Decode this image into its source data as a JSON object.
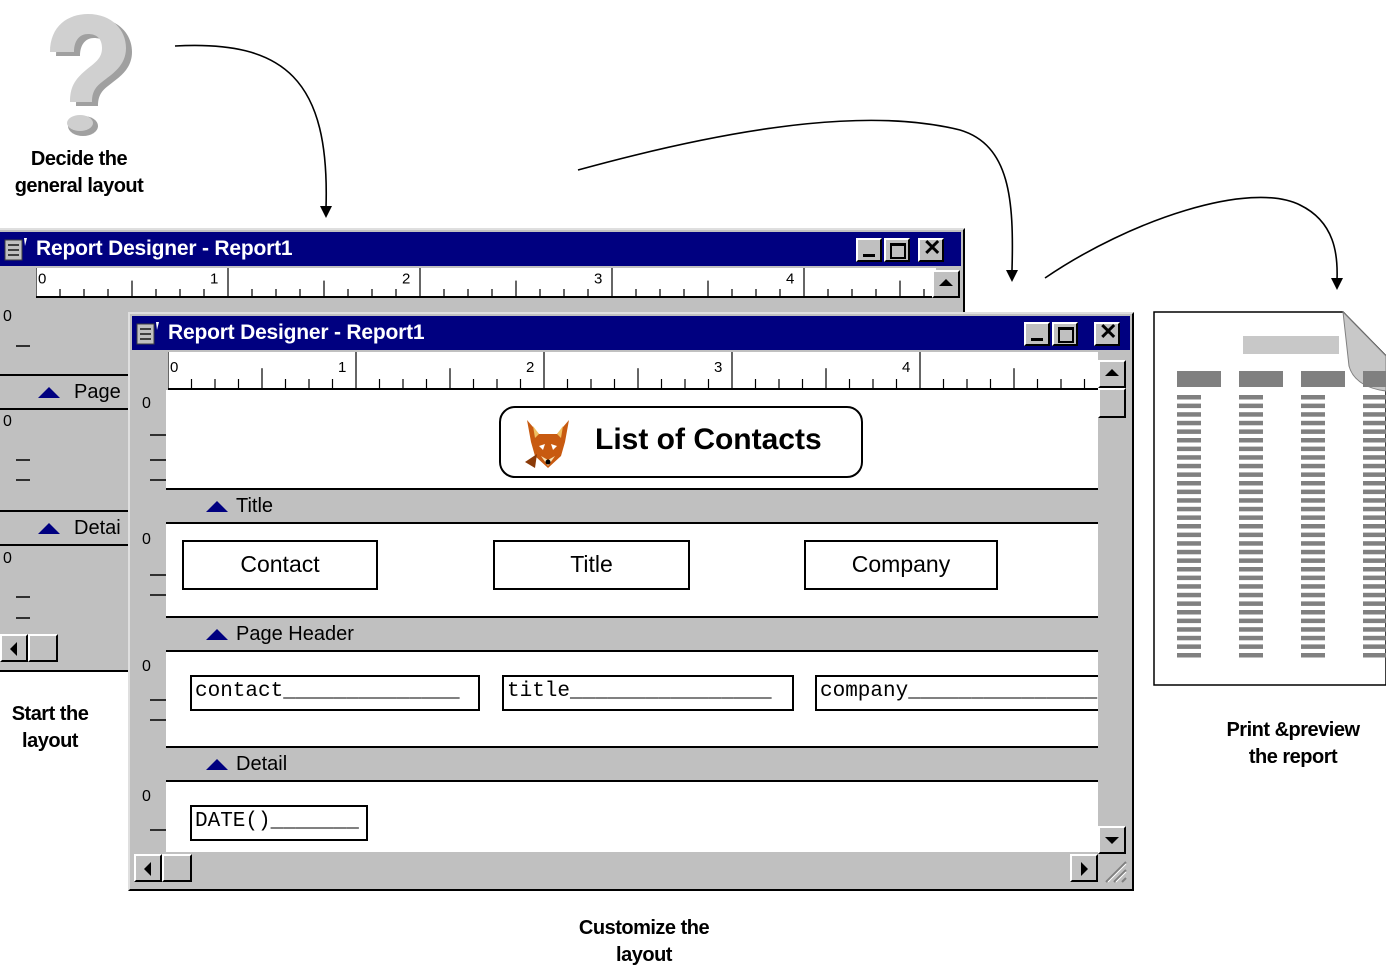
{
  "captions": {
    "decide_line1": "Decide the",
    "decide_line2": "general layout",
    "start_line1": "Start the",
    "start_line2": "layout",
    "customize_line1": "Customize the",
    "customize_line2": "layout",
    "print_line1": "Print &preview",
    "print_line2": "the report"
  },
  "back_window": {
    "title": "Report Designer - Report1",
    "ruler_numbers": [
      "0",
      "1",
      "2",
      "3",
      "4"
    ],
    "vruler_zero": "0",
    "bands": [
      "Page",
      "Detai"
    ]
  },
  "front_window": {
    "title": "Report Designer - Report1",
    "ruler_numbers": [
      "0",
      "1",
      "2",
      "3",
      "4"
    ],
    "vruler_zero": "0",
    "report_title": "List of Contacts",
    "bands": {
      "title": "Title",
      "page_header": "Page Header",
      "detail": "Detail"
    },
    "header_labels": [
      "Contact",
      "Title",
      "Company"
    ],
    "detail_fields": [
      "contact______________",
      "title________________",
      "company_______________"
    ],
    "footer_field": "DATE()_______"
  },
  "icons": {
    "question": "question-mark-icon",
    "fox": "fox-icon",
    "app": "report-designer-icon",
    "page": "report-page-icon"
  }
}
